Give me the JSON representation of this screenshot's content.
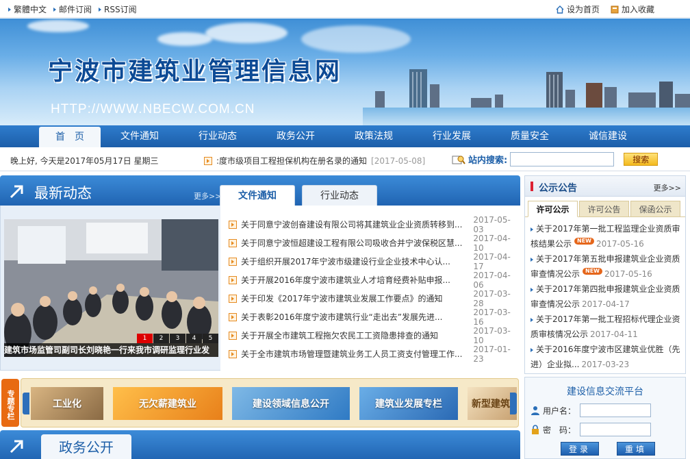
{
  "topbar": {
    "links": [
      "繁體中文",
      "邮件订阅",
      "RSS订阅"
    ],
    "set_home": "设为首页",
    "add_fav": "加入收藏"
  },
  "banner": {
    "title": "宁波市建筑业管理信息网",
    "url": "HTTP://WWW.NBECW.COM.CN"
  },
  "nav": {
    "items": [
      "首　页",
      "文件通知",
      "行业动态",
      "政务公开",
      "政策法规",
      "行业发展",
      "质量安全",
      "诚信建设"
    ],
    "active_index": 0
  },
  "infobar": {
    "greeting": "晚上好, 今天是2017年05月17日 星期三",
    "ticker_text": ":度市级项目工程担保机构在册名录的通知",
    "ticker_date": "[2017-05-08]",
    "search_label": "站内搜索:",
    "search_value": "",
    "search_button": "搜索"
  },
  "latest": {
    "title": "最新动态",
    "more": "更多>>",
    "tabs": [
      "文件通知",
      "行业动态"
    ],
    "active_tab": 0,
    "slide_caption": "建筑市场监管司副司长刘晓艳一行来我市调研监理行业发",
    "slide_pages": [
      "1",
      "2",
      "3",
      "4",
      "5"
    ],
    "slide_active": 0,
    "news": [
      {
        "title": "关于同意宁波创奋建设有限公司将其建筑业企业资质转移到...",
        "date": "2017-05-03"
      },
      {
        "title": "关于同意宁波恒超建设工程有限公司吸收合并宁波保税区慧...",
        "date": "2017-04-10"
      },
      {
        "title": "关于组织开展2017年宁波市级建设行业企业技术中心认...",
        "date": "2017-04-17"
      },
      {
        "title": "关于开展2016年度宁波市建筑业人才培育经费补贴申报...",
        "date": "2017-04-06"
      },
      {
        "title": "关于印发《2017年宁波市建筑业发展工作要点》的通知",
        "date": "2017-03-28"
      },
      {
        "title": "关于表彰2016年度宁波市建筑行业“走出去”发展先进...",
        "date": "2017-03-16"
      },
      {
        "title": "关于开展全市建筑工程拖欠农民工工资隐患排查的通知",
        "date": "2017-03-10"
      },
      {
        "title": "关于全市建筑市场管理暨建筑业务工人员工资支付管理工作...",
        "date": "2017-01-23"
      }
    ]
  },
  "notice": {
    "title": "公示公告",
    "more": "更多>>",
    "tabs": [
      "许可公示",
      "许可公告",
      "保函公示"
    ],
    "active_tab": 0,
    "items": [
      {
        "title": "关于2017年第一批工程监理企业资质审核结果公示",
        "date": "2017-05-16",
        "new": "NEW"
      },
      {
        "title": "关于2017年第五批申报建筑业企业资质审查情况公示",
        "date": "2017-05-16",
        "new": "NEW"
      },
      {
        "title": "关于2017年第四批申报建筑业企业资质审查情况公示",
        "date": "2017-04-17",
        "new": ""
      },
      {
        "title": "关于2017年第一批工程招标代理企业资质审核情况公示",
        "date": "2017-04-11",
        "new": ""
      },
      {
        "title": "关于2016年度宁波市区建筑业优胜（先进）企业拟...",
        "date": "2017-03-23",
        "new": ""
      }
    ]
  },
  "special": {
    "side_label": "专题专栏",
    "cards": [
      "工业化",
      "无欠薪建筑业",
      "建设领域信息公开",
      "建筑业发展专栏",
      "新型建筑"
    ]
  },
  "gov": {
    "title": "政务公开"
  },
  "platform": {
    "title": "建设信息交流平台",
    "user_label": "用户名：",
    "pass_label": "密　码：",
    "login": "登录",
    "reset": "重填"
  },
  "colors": {
    "nav_blue": "#2064b2",
    "accent_orange": "#e86a12",
    "search_button": "#f3b91e"
  }
}
